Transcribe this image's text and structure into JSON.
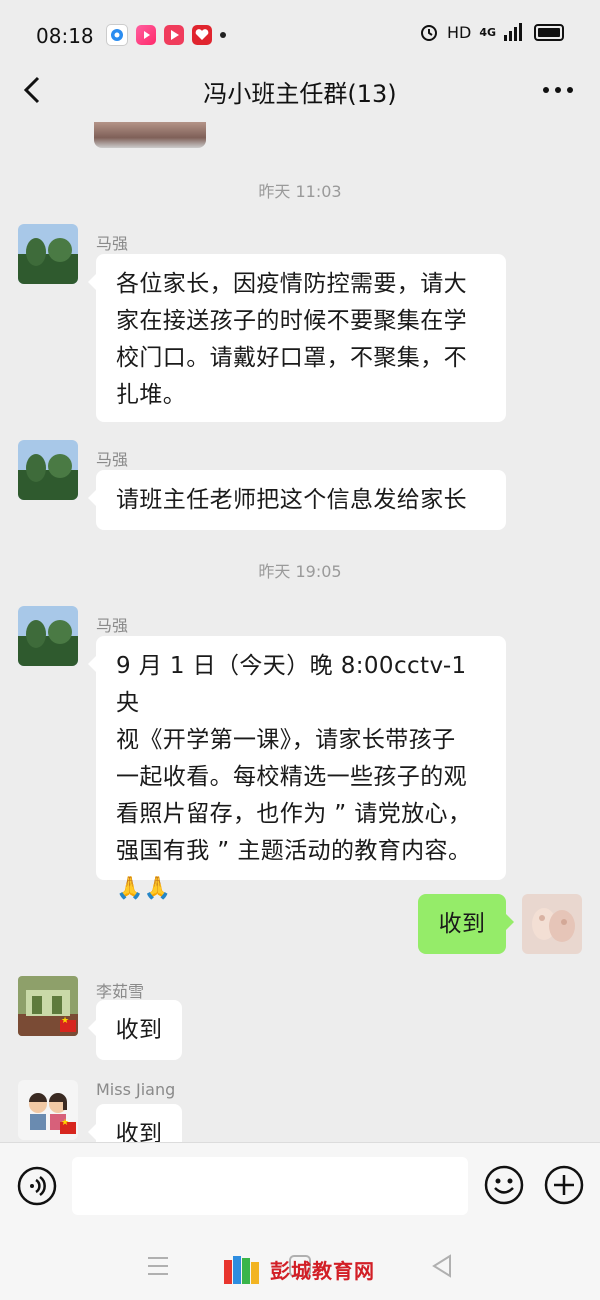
{
  "status_bar": {
    "time": "08:18",
    "hd": "HD",
    "network": "4G",
    "icons": [
      "wechat-app-icon",
      "video-app-icon",
      "play-app-icon",
      "heart-app-icon",
      "alarm-icon",
      "signal-icon",
      "battery-icon"
    ]
  },
  "header": {
    "title": "冯小班主任群(13)",
    "back_icon": "chevron-left-icon",
    "more_icon": "more-icon"
  },
  "chat": {
    "timestamps": [
      "昨天 11:03",
      "昨天 19:05"
    ],
    "messages": [
      {
        "sender": "马强",
        "lines": [
          "各位家长，因疫情防控需要，请大",
          "家在接送孩子的时候不要聚集在学",
          "校门口。请戴好口罩，不聚集，不",
          "扎堆。"
        ]
      },
      {
        "sender": "马强",
        "lines": [
          "请班主任老师把这个信息发给家长"
        ]
      },
      {
        "sender": "马强",
        "lines": [
          "9 月 1 日（今天）晚 8:00cctv-1 央",
          "视《开学第一课》，请家长带孩子",
          "一起收看。每校精选一些孩子的观",
          "看照片留存，也作为 ” 请党放心，",
          "强国有我 ” 主题活动的教育内容。"
        ],
        "emoji": "🙏🙏"
      },
      {
        "sender": "",
        "outgoing": true,
        "text": "收到"
      },
      {
        "sender": "李茹雪",
        "text": "收到"
      },
      {
        "sender": "Miss  Jiang",
        "text": "收到"
      }
    ]
  },
  "input_bar": {
    "placeholder": "",
    "voice_icon": "voice-icon",
    "emoji_icon": "emoji-icon",
    "plus_icon": "plus-icon"
  },
  "watermark": {
    "text": "彭城教育网"
  },
  "colors": {
    "background": "#ededed",
    "bubble_in": "#ffffff",
    "bubble_out": "#95ec69",
    "watermark": "#d21f26"
  }
}
